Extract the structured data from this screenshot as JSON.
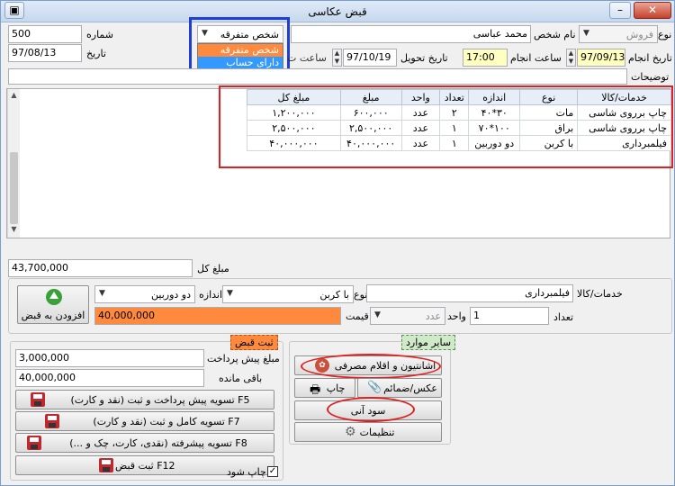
{
  "window": {
    "title": "قبض عكاسی",
    "minimize": "–",
    "maximize": "□",
    "close": "✕"
  },
  "header": {
    "number_label": "شماره",
    "number_value": "500",
    "date_label": "تاریخ",
    "date_value": "97/08/13",
    "type_label": "نوع",
    "type_value": "فروش",
    "person_label": "نام شخص",
    "person_value": "محمد عباسی",
    "person_type_value": "شخص متفرقه",
    "person_type_options": [
      "شخص متفرقه",
      "دارای حساب"
    ],
    "do_date_label": "تاریخ انجام",
    "do_date_value": "97/09/13",
    "do_time_label": "ساعت انجام",
    "do_time_value": "17:00",
    "delivery_date_label": "تاریخ تحویل",
    "delivery_date_value": "97/10/19",
    "delivery_time_label": "ساعت ت",
    "notes_label": "توضیحات",
    "notes_value": ""
  },
  "grid": {
    "columns": [
      "خدمات/کالا",
      "نوع",
      "اندازه",
      "تعداد",
      "واحد",
      "مبلغ",
      "مبلغ کل"
    ],
    "rows": [
      [
        "چاپ برروی شاسی",
        "مات",
        "۳۰*۴۰",
        "۲",
        "عدد",
        "۶۰۰,۰۰۰",
        "۱,۲۰۰,۰۰۰"
      ],
      [
        "چاپ برروی شاسی",
        "براق",
        "۱۰۰*۷۰",
        "۱",
        "عدد",
        "۲,۵۰۰,۰۰۰",
        "۲,۵۰۰,۰۰۰"
      ],
      [
        "فیلمبرداری",
        "با کربن",
        "دو دوربین",
        "۱",
        "عدد",
        "۴۰,۰۰۰,۰۰۰",
        "۴۰,۰۰۰,۰۰۰"
      ]
    ]
  },
  "total": {
    "label": "مبلغ کل",
    "value": "43,700,000"
  },
  "item_editor": {
    "service_label": "خدمات/کالا",
    "service_value": "فیلمبرداری",
    "type_label": "نوع",
    "type_value": "با کربن",
    "size_label": "اندازه",
    "size_value": "دو دوربین",
    "qty_label": "تعداد",
    "qty_value": "1",
    "unit_label": "واحد",
    "unit_value": "عدد",
    "price_label": "قیمت",
    "price_value": "40,000,000",
    "add_button": "افزودن به قبض"
  },
  "payment": {
    "group_title": "ثبت قبض",
    "prepay_label": "مبلغ پیش پرداخت",
    "prepay_value": "3,000,000",
    "remaining_label": "باقی مانده",
    "remaining_value": "40,000,000",
    "btn_f5": "تسویه پیش پرداخت و ثبت (نقد و کارت) F5",
    "btn_f7": "تسویه کامل و ثبت (نقد و کارت) F7",
    "btn_f8": "تسویه پیشرفته (نقدی، کارت، چک و ...) F8",
    "btn_f12": "ثبت قبض F12",
    "print_label": "چاپ شود",
    "print_checked": "✓"
  },
  "other": {
    "group_title": "سایر موارد",
    "btn_equipment": "اشانتیون و اقلام مصرفی",
    "btn_photo": "عکس/ضمائم",
    "btn_print": "چاپ",
    "btn_profit": "سود آنی",
    "btn_settings": "تنظیمات"
  },
  "colors": {
    "annotation_red": "#e02020",
    "annotation_blue": "#1e3ed6",
    "highlight_orange": "#ff8a3d",
    "time_yellow": "#ffffc0",
    "dropdown_selected": "#3399ff"
  }
}
